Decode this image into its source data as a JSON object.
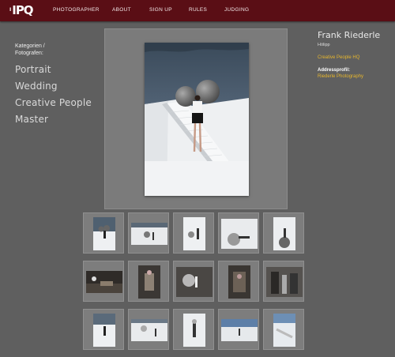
{
  "header": {
    "logo_prefix": "I",
    "logo_text": "IPQ",
    "nav": [
      "PHOTOGRAPHER",
      "ABOUT",
      "SIGN UP",
      "RULES",
      "JUDGING"
    ]
  },
  "sidebar": {
    "label": "Kategorien / Fotografen:",
    "categories": [
      "Portrait",
      "Wedding",
      "Creative People",
      "Master"
    ]
  },
  "info": {
    "name": "Frank Riederle",
    "subtitle": "Hölipp",
    "category_link": "Creative People HQ",
    "address_label": "Addressprofil:",
    "address_link": "Riederle Photography"
  },
  "colors": {
    "topbar": "#5a0e15",
    "background": "#5f5f5f",
    "link": "#e6b62e"
  }
}
